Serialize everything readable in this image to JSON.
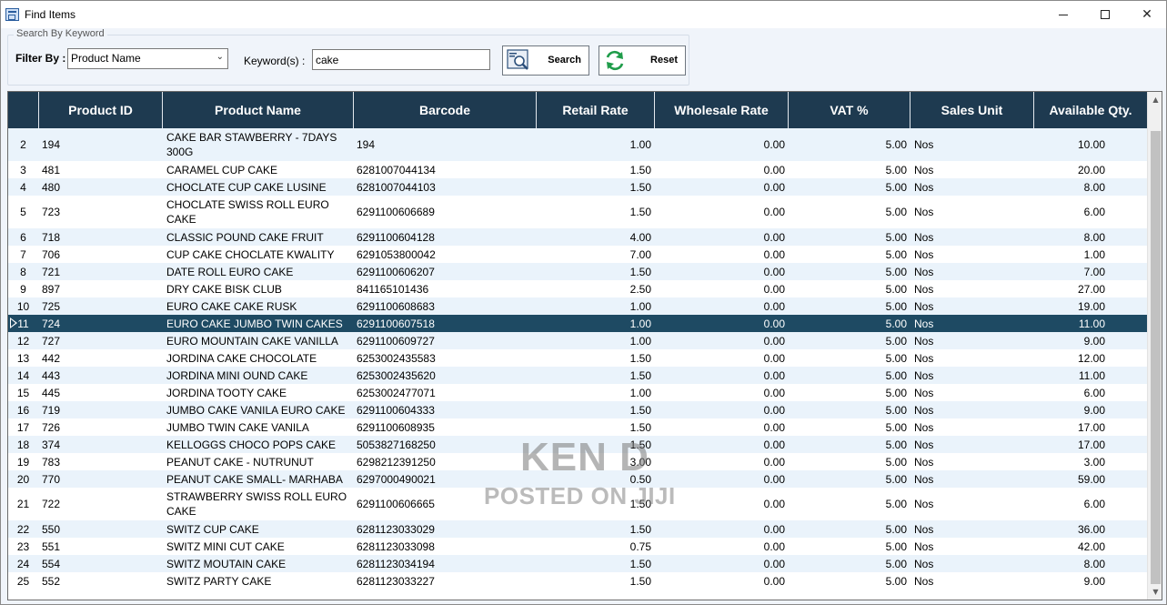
{
  "window": {
    "title": "Find Items",
    "minimize_glyph": "",
    "close_glyph": "✕"
  },
  "search_group": {
    "legend": "Search By Keyword",
    "filter_label": "Filter By :",
    "filter_value": "Product Name",
    "keyword_label": "Keyword(s) :",
    "keyword_value": "cake",
    "search_label": "Search",
    "reset_label": "Reset"
  },
  "grid": {
    "columns": [
      "Product ID",
      "Product Name",
      "Barcode",
      "Retail Rate",
      "Wholesale Rate",
      "VAT %",
      "Sales Unit",
      "Available Qty."
    ],
    "selected_index": "11",
    "rows": [
      {
        "idx": "2",
        "id": "194",
        "name": "CAKE BAR STAWBERRY - 7DAYS 300G",
        "barcode": "194",
        "retail": "1.00",
        "wholesale": "0.00",
        "vat": "5.00",
        "unit": "Nos",
        "qty": "10.00"
      },
      {
        "idx": "3",
        "id": "481",
        "name": "CARAMEL CUP CAKE",
        "barcode": "6281007044134",
        "retail": "1.50",
        "wholesale": "0.00",
        "vat": "5.00",
        "unit": "Nos",
        "qty": "20.00"
      },
      {
        "idx": "4",
        "id": "480",
        "name": "CHOCLATE CUP CAKE LUSINE",
        "barcode": "6281007044103",
        "retail": "1.50",
        "wholesale": "0.00",
        "vat": "5.00",
        "unit": "Nos",
        "qty": "8.00"
      },
      {
        "idx": "5",
        "id": "723",
        "name": "CHOCLATE SWISS ROLL EURO CAKE",
        "barcode": "6291100606689",
        "retail": "1.50",
        "wholesale": "0.00",
        "vat": "5.00",
        "unit": "Nos",
        "qty": "6.00"
      },
      {
        "idx": "6",
        "id": "718",
        "name": "CLASSIC POUND CAKE FRUIT",
        "barcode": "6291100604128",
        "retail": "4.00",
        "wholesale": "0.00",
        "vat": "5.00",
        "unit": "Nos",
        "qty": "8.00"
      },
      {
        "idx": "7",
        "id": "706",
        "name": "CUP CAKE CHOCLATE KWALITY",
        "barcode": "6291053800042",
        "retail": "7.00",
        "wholesale": "0.00",
        "vat": "5.00",
        "unit": "Nos",
        "qty": "1.00"
      },
      {
        "idx": "8",
        "id": "721",
        "name": "DATE ROLL EURO CAKE",
        "barcode": "6291100606207",
        "retail": "1.50",
        "wholesale": "0.00",
        "vat": "5.00",
        "unit": "Nos",
        "qty": "7.00"
      },
      {
        "idx": "9",
        "id": "897",
        "name": "DRY CAKE BISK CLUB",
        "barcode": "841165101436",
        "retail": "2.50",
        "wholesale": "0.00",
        "vat": "5.00",
        "unit": "Nos",
        "qty": "27.00"
      },
      {
        "idx": "10",
        "id": "725",
        "name": "EURO CAKE CAKE RUSK",
        "barcode": "6291100608683",
        "retail": "1.00",
        "wholesale": "0.00",
        "vat": "5.00",
        "unit": "Nos",
        "qty": "19.00"
      },
      {
        "idx": "11",
        "id": "724",
        "name": "EURO CAKE JUMBO TWIN CAKES",
        "barcode": "6291100607518",
        "retail": "1.00",
        "wholesale": "0.00",
        "vat": "5.00",
        "unit": "Nos",
        "qty": "11.00"
      },
      {
        "idx": "12",
        "id": "727",
        "name": "EURO MOUNTAIN CAKE VANILLA",
        "barcode": "6291100609727",
        "retail": "1.00",
        "wholesale": "0.00",
        "vat": "5.00",
        "unit": "Nos",
        "qty": "9.00"
      },
      {
        "idx": "13",
        "id": "442",
        "name": "JORDINA CAKE CHOCOLATE",
        "barcode": "6253002435583",
        "retail": "1.50",
        "wholesale": "0.00",
        "vat": "5.00",
        "unit": "Nos",
        "qty": "12.00"
      },
      {
        "idx": "14",
        "id": "443",
        "name": "JORDINA MINI OUND CAKE",
        "barcode": "6253002435620",
        "retail": "1.50",
        "wholesale": "0.00",
        "vat": "5.00",
        "unit": "Nos",
        "qty": "11.00"
      },
      {
        "idx": "15",
        "id": "445",
        "name": "JORDINA TOOTY CAKE",
        "barcode": "6253002477071",
        "retail": "1.00",
        "wholesale": "0.00",
        "vat": "5.00",
        "unit": "Nos",
        "qty": "6.00"
      },
      {
        "idx": "16",
        "id": "719",
        "name": "JUMBO CAKE VANILA EURO CAKE",
        "barcode": "6291100604333",
        "retail": "1.50",
        "wholesale": "0.00",
        "vat": "5.00",
        "unit": "Nos",
        "qty": "9.00"
      },
      {
        "idx": "17",
        "id": "726",
        "name": "JUMBO TWIN CAKE VANILA",
        "barcode": "6291100608935",
        "retail": "1.50",
        "wholesale": "0.00",
        "vat": "5.00",
        "unit": "Nos",
        "qty": "17.00"
      },
      {
        "idx": "18",
        "id": "374",
        "name": "KELLOGGS CHOCO POPS CAKE",
        "barcode": "5053827168250",
        "retail": "1.50",
        "wholesale": "0.00",
        "vat": "5.00",
        "unit": "Nos",
        "qty": "17.00"
      },
      {
        "idx": "19",
        "id": "783",
        "name": "PEANUT CAKE - NUTRUNUT",
        "barcode": "6298212391250",
        "retail": "3.00",
        "wholesale": "0.00",
        "vat": "5.00",
        "unit": "Nos",
        "qty": "3.00"
      },
      {
        "idx": "20",
        "id": "770",
        "name": "PEANUT CAKE SMALL- MARHABA",
        "barcode": "6297000490021",
        "retail": "0.50",
        "wholesale": "0.00",
        "vat": "5.00",
        "unit": "Nos",
        "qty": "59.00"
      },
      {
        "idx": "21",
        "id": "722",
        "name": "STRAWBERRY SWISS ROLL EURO CAKE",
        "barcode": "6291100606665",
        "retail": "1.50",
        "wholesale": "0.00",
        "vat": "5.00",
        "unit": "Nos",
        "qty": "6.00"
      },
      {
        "idx": "22",
        "id": "550",
        "name": "SWITZ CUP CAKE",
        "barcode": "6281123033029",
        "retail": "1.50",
        "wholesale": "0.00",
        "vat": "5.00",
        "unit": "Nos",
        "qty": "36.00"
      },
      {
        "idx": "23",
        "id": "551",
        "name": "SWITZ MINI CUT CAKE",
        "barcode": "6281123033098",
        "retail": "0.75",
        "wholesale": "0.00",
        "vat": "5.00",
        "unit": "Nos",
        "qty": "42.00"
      },
      {
        "idx": "24",
        "id": "554",
        "name": "SWITZ MOUTAIN CAKE",
        "barcode": "6281123034194",
        "retail": "1.50",
        "wholesale": "0.00",
        "vat": "5.00",
        "unit": "Nos",
        "qty": "8.00"
      },
      {
        "idx": "25",
        "id": "552",
        "name": "SWITZ PARTY CAKE",
        "barcode": "6281123033227",
        "retail": "1.50",
        "wholesale": "0.00",
        "vat": "5.00",
        "unit": "Nos",
        "qty": "9.00"
      }
    ]
  },
  "watermark": {
    "line1": "KEN D",
    "line2": "POSTED ON JIJI"
  }
}
